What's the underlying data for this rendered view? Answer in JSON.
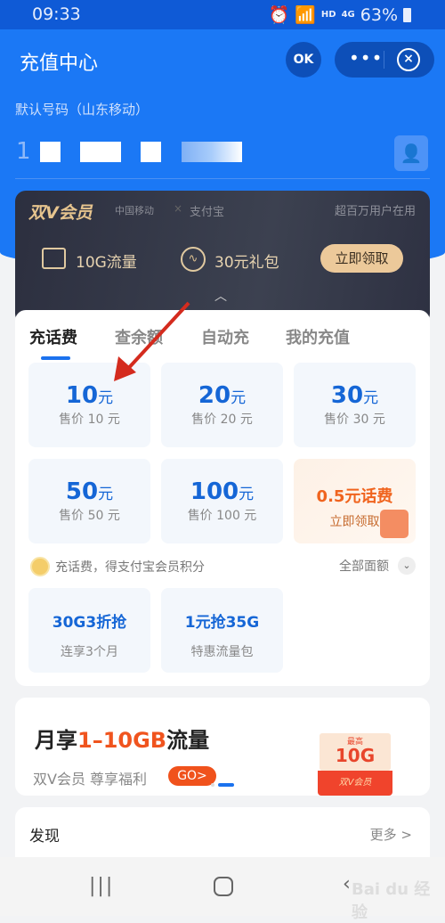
{
  "status_bar": {
    "time": "09:33",
    "network": "4G",
    "hd": "HD",
    "battery": "63%"
  },
  "header": {
    "title": "充值中心",
    "mini_icon": "OK",
    "more": "•••",
    "close": "×"
  },
  "phone": {
    "label": "默认号码（山东移动）",
    "number_masked": "1"
  },
  "vip": {
    "brand": "双V会员",
    "partner1": "中国移动",
    "partner2": "支付宝",
    "users": "超百万用户在用",
    "benefit1": "10G流量",
    "benefit2": "30元礼包",
    "claim_button": "立即领取"
  },
  "tabs": [
    "充话费",
    "查余额",
    "自动充",
    "我的充值"
  ],
  "recharge": [
    {
      "amount": "10",
      "unit": "元",
      "price": "售价 10 元"
    },
    {
      "amount": "20",
      "unit": "元",
      "price": "售价 20 元"
    },
    {
      "amount": "30",
      "unit": "元",
      "price": "售价 30 元"
    },
    {
      "amount": "50",
      "unit": "元",
      "price": "售价 50 元"
    },
    {
      "amount": "100",
      "unit": "元",
      "price": "售价 100 元"
    }
  ],
  "promo": {
    "title": "0.5元话费",
    "action": "立即领取"
  },
  "points": {
    "text": "充话费，得支付宝会员积分",
    "all": "全部面额"
  },
  "data_packs": [
    {
      "title": "30G3折抢",
      "sub": "连享3个月"
    },
    {
      "title": "1元抢35G",
      "sub": "特惠流量包"
    }
  ],
  "banner": {
    "title_a": "月享",
    "title_b": "1–10GB",
    "title_c": "流量",
    "sub": "双V会员 尊享福利",
    "go": "GO>",
    "gift_top": "最高",
    "gift_amount": "10G",
    "gift_label": "双V会员"
  },
  "discover": {
    "title": "发现",
    "more": "更多 >"
  },
  "colors": {
    "primary": "#1b78f5",
    "accent": "#f0541e",
    "annotation_arrow": "#d42b1e"
  }
}
